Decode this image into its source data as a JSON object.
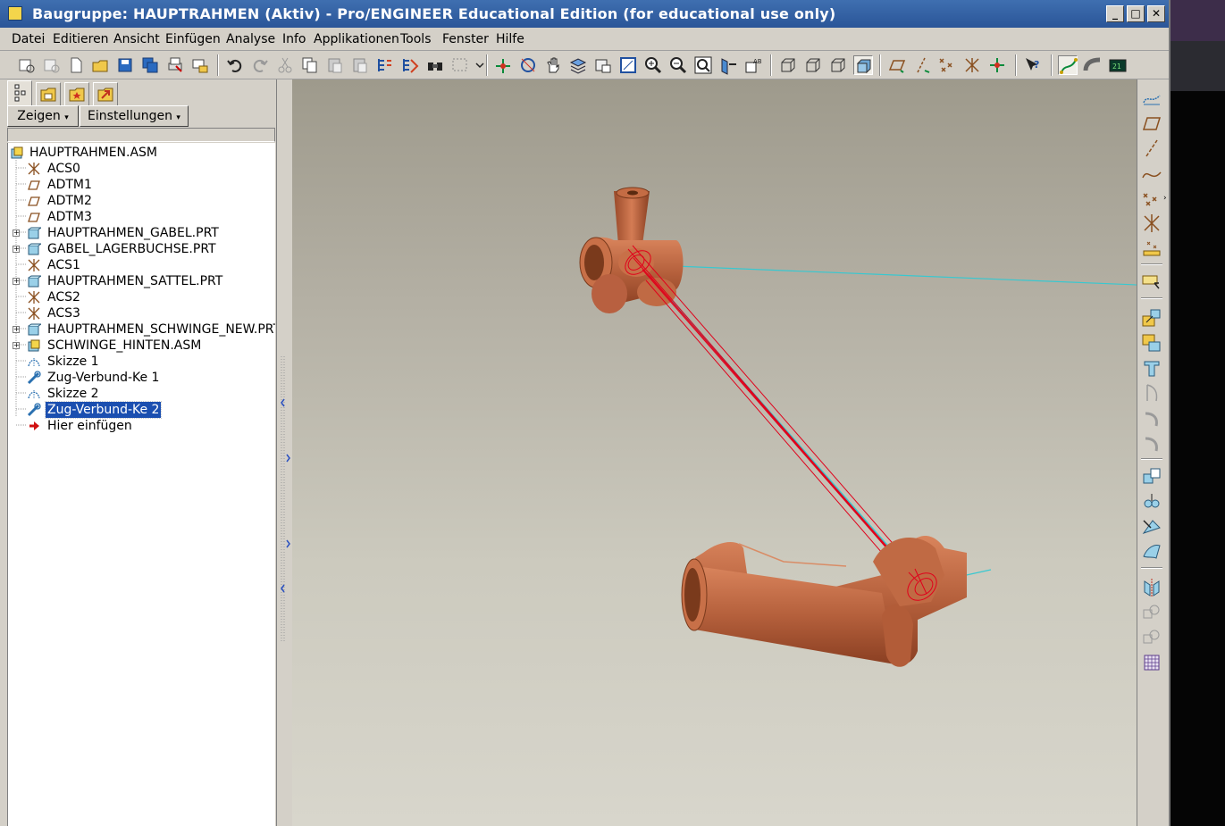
{
  "window": {
    "title": "Baugruppe: HAUPTRAHMEN (Aktiv) - Pro/ENGINEER Educational Edition (for educational use only)",
    "buttons": {
      "minimize": "_",
      "maximize": "□",
      "close": "✕"
    }
  },
  "menu": [
    "Datei",
    "Editieren",
    "Ansicht",
    "Einfügen",
    "Analyse",
    "Info",
    "Applikationen",
    "Tools",
    "Fenster",
    "Hilfe"
  ],
  "navigator": {
    "show_button": "Zeigen",
    "settings_button": "Einstellungen",
    "tabs": [
      "model-tree-tab",
      "folder-browser-tab",
      "favorites-tab",
      "connections-tab"
    ]
  },
  "tree": {
    "items": [
      {
        "label": "HAUPTRAHMEN.ASM",
        "icon": "assembly-icon"
      },
      {
        "label": "ACS0",
        "icon": "coordinate-system-icon"
      },
      {
        "label": "ADTM1",
        "icon": "datum-plane-icon"
      },
      {
        "label": "ADTM2",
        "icon": "datum-plane-icon"
      },
      {
        "label": "ADTM3",
        "icon": "datum-plane-icon"
      },
      {
        "label": "HAUPTRAHMEN_GABEL.PRT",
        "icon": "part-icon"
      },
      {
        "label": "GABEL_LAGERBUCHSE.PRT",
        "icon": "part-icon"
      },
      {
        "label": "ACS1",
        "icon": "coordinate-system-icon"
      },
      {
        "label": "HAUPTRAHMEN_SATTEL.PRT",
        "icon": "part-icon"
      },
      {
        "label": "ACS2",
        "icon": "coordinate-system-icon"
      },
      {
        "label": "ACS3",
        "icon": "coordinate-system-icon"
      },
      {
        "label": "HAUPTRAHMEN_SCHWINGE_NEW.PRT",
        "icon": "part-icon"
      },
      {
        "label": "SCHWINGE_HINTEN.ASM",
        "icon": "assembly-icon"
      },
      {
        "label": "Skizze 1",
        "icon": "sketch-icon"
      },
      {
        "label": "Zug-Verbund-Ke 1",
        "icon": "swept-blend-icon"
      },
      {
        "label": "Skizze 2",
        "icon": "sketch-icon"
      },
      {
        "label": "Zug-Verbund-Ke 2",
        "icon": "swept-blend-icon",
        "selected": true
      },
      {
        "label": "Hier einfügen",
        "icon": "insert-here-arrow-icon"
      }
    ]
  },
  "colors": {
    "titlebar": "#2f5fa3",
    "part": "#b5603c",
    "selection_highlight": "#e0001b",
    "datum_axis": "#38c8d0",
    "tree_selection": "#1b4fb0"
  }
}
